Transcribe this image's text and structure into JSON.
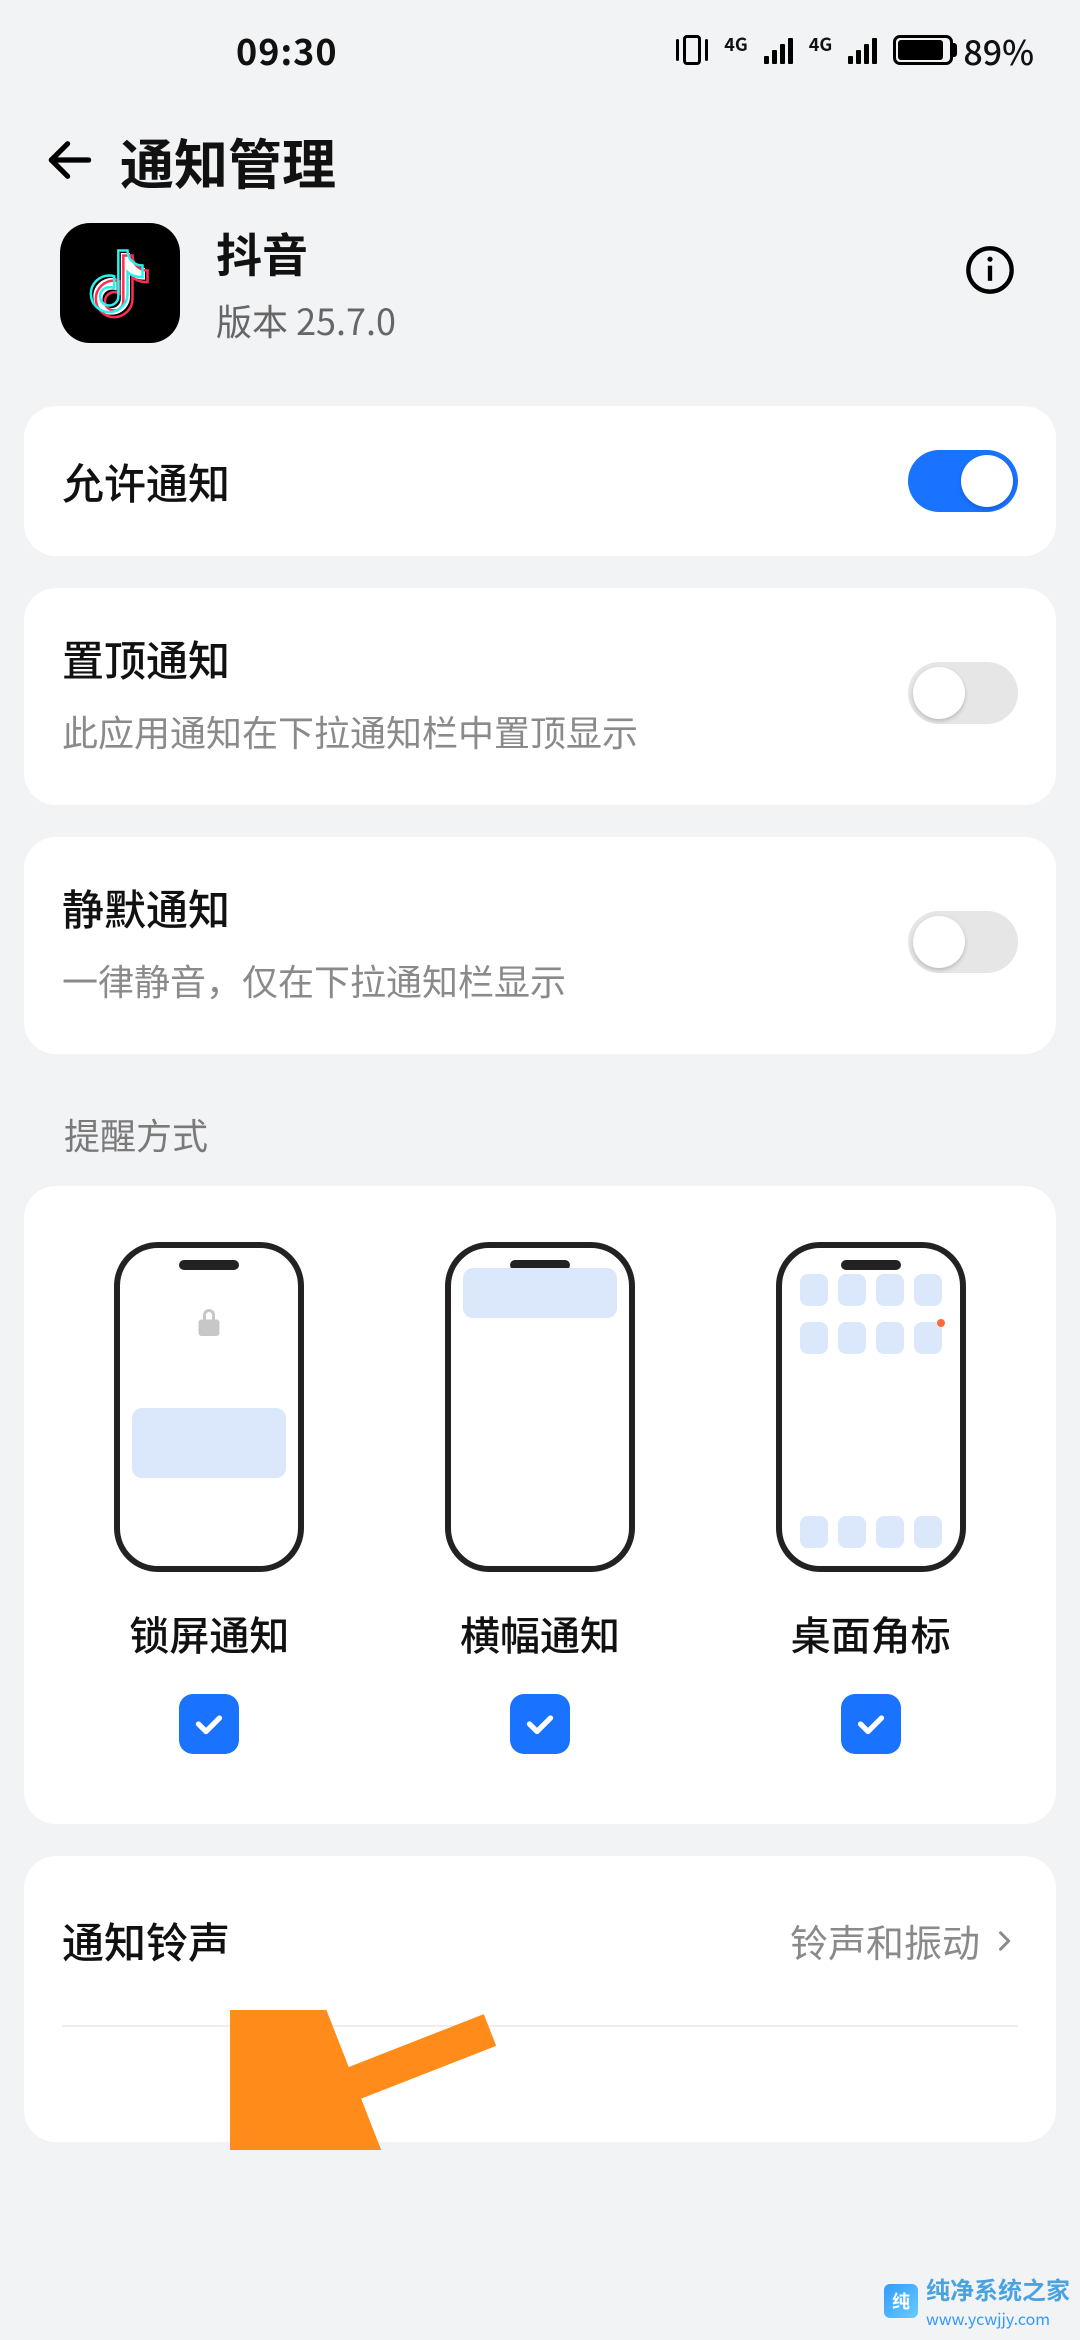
{
  "status": {
    "time": "09:30",
    "net_tag": "4G",
    "battery_pct": "89%",
    "battery_fill_pct": 89
  },
  "header": {
    "title": "通知管理"
  },
  "app": {
    "name": "抖音",
    "version_label": "版本 25.7.0"
  },
  "rows": {
    "allow": {
      "title": "允许通知",
      "on": true
    },
    "pin": {
      "title": "置顶通知",
      "sub": "此应用通知在下拉通知栏中置顶显示",
      "on": false
    },
    "silent": {
      "title": "静默通知",
      "sub": "一律静音，仅在下拉通知栏显示",
      "on": false
    }
  },
  "section_label": "提醒方式",
  "styles": {
    "options": [
      {
        "label": "锁屏通知",
        "checked": true
      },
      {
        "label": "横幅通知",
        "checked": true
      },
      {
        "label": "桌面角标",
        "checked": true
      }
    ]
  },
  "ringtone": {
    "title": "通知铃声",
    "value": "铃声和振动"
  },
  "watermark": {
    "text": "纯净系统之家",
    "sub": "www.ycwjjy.com"
  }
}
